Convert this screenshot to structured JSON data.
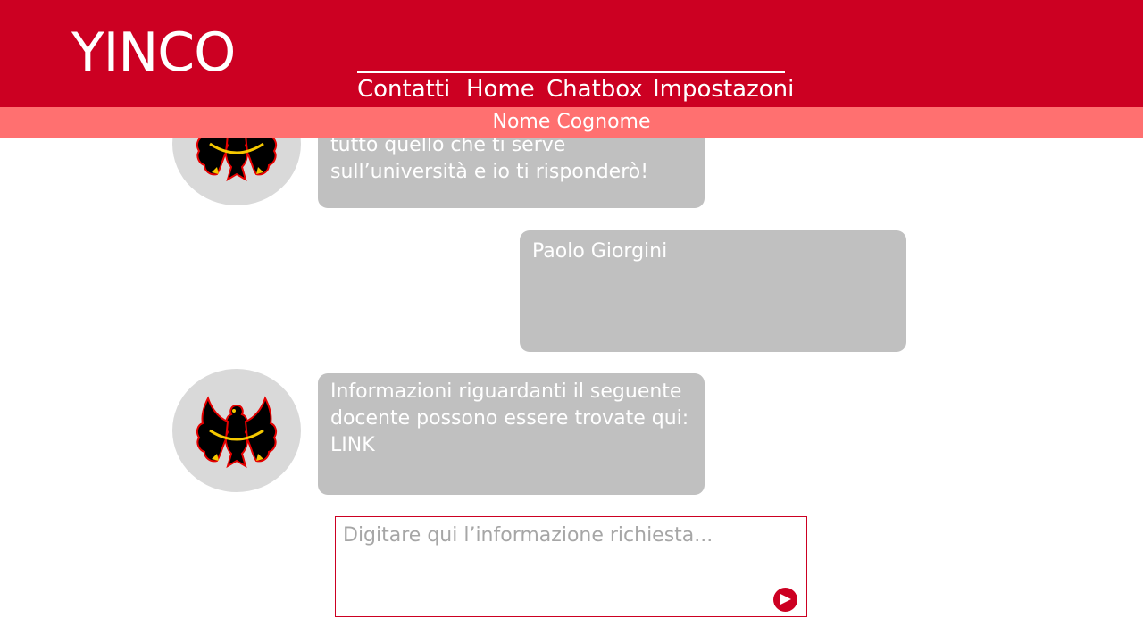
{
  "header": {
    "logo": "YINCO",
    "nav": {
      "contatti": "Contatti",
      "home": "Home",
      "chatbox": "Chatbox",
      "impostazioni": "Impostazoni"
    }
  },
  "subheader": {
    "user_name": "Nome Cognome"
  },
  "chat": {
    "messages": [
      {
        "sender": "bot",
        "text": "dell’Università di Trento. Chiedimi tutto quello che ti serve sull’università e io ti risponderò!"
      },
      {
        "sender": "user",
        "text": "Paolo Giorgini"
      },
      {
        "sender": "bot",
        "text": "Informazioni riguardanti il seguente docente possono essere trovate qui: LINK"
      }
    ]
  },
  "input": {
    "placeholder": "Digitare qui l’informazione richiesta...",
    "value": ""
  },
  "colors": {
    "header_bg": "#cc0022",
    "subheader_bg": "#ff7070",
    "bubble_bg": "#c0c0c0",
    "avatar_bg": "#d9d9d9"
  },
  "icons": {
    "avatar": "eagle-coat-of-arms-icon",
    "send": "send-arrow-icon"
  }
}
